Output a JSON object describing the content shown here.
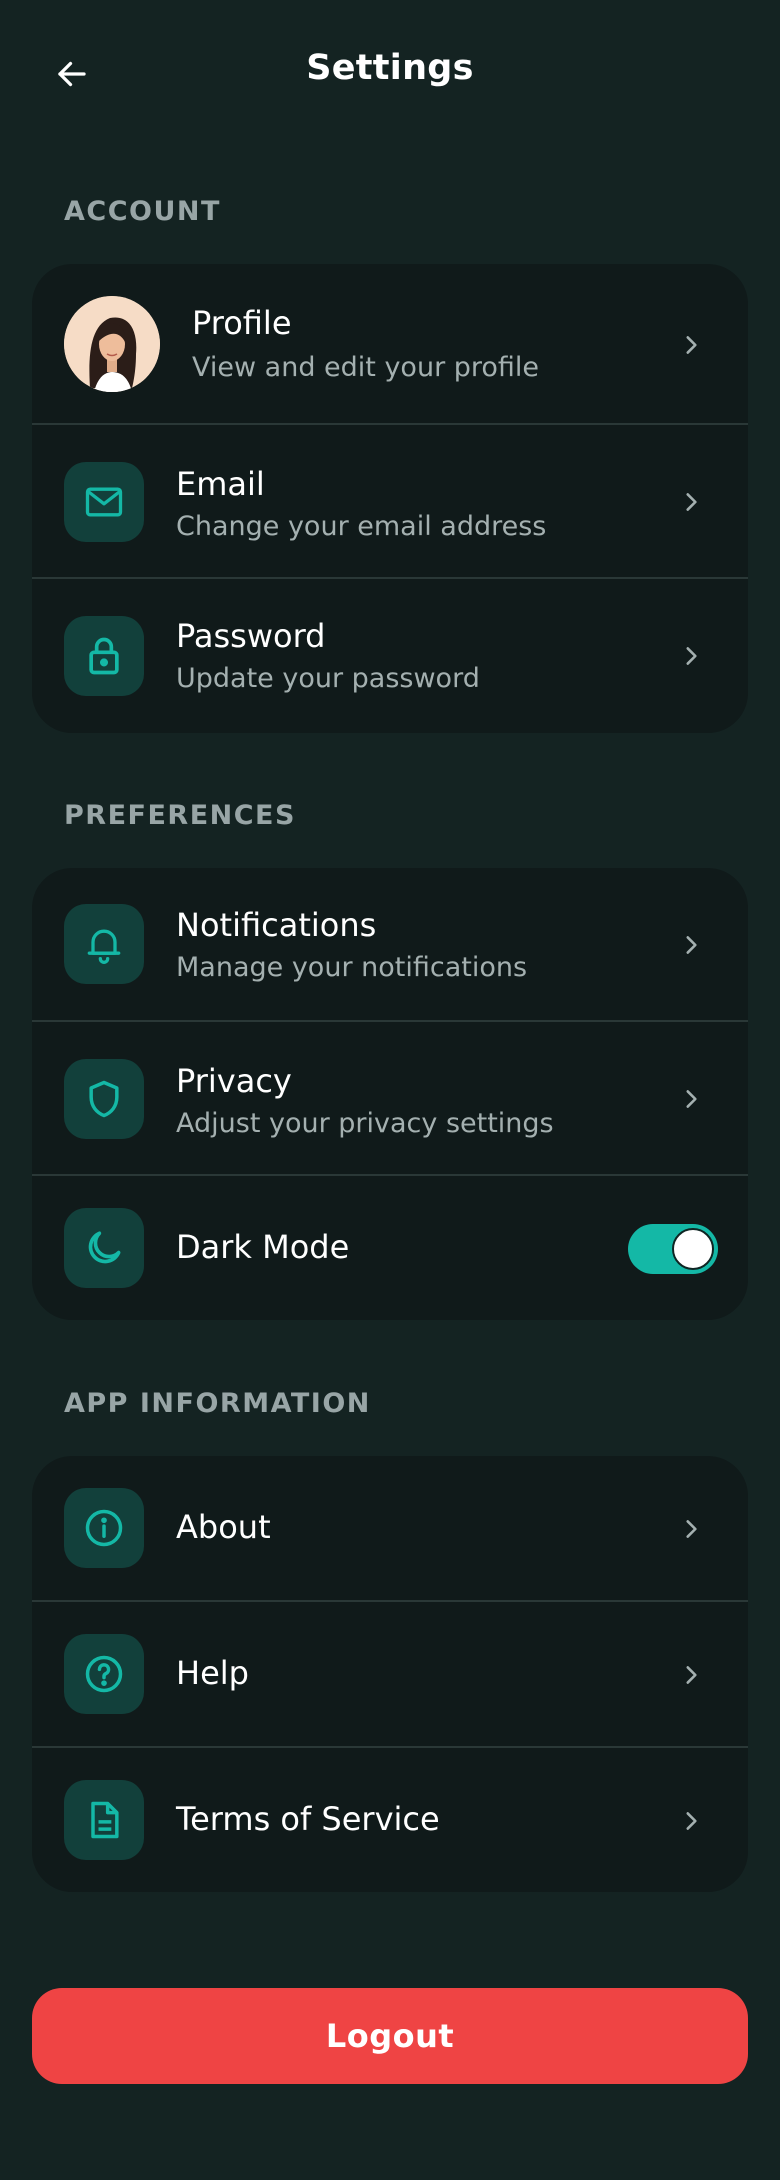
{
  "header": {
    "title": "Settings",
    "back_icon": "arrow-left-icon"
  },
  "colors": {
    "background": "#142322",
    "card": "#101a1a",
    "accent": "#14b8a6",
    "icon_bg": "#12403b",
    "danger": "#ef4444",
    "muted": "#a4b0b0"
  },
  "account": {
    "label": "ACCOUNT",
    "items": [
      {
        "title": "Profile",
        "subtitle": "View and edit your profile",
        "icon": "avatar"
      },
      {
        "title": "Email",
        "subtitle": "Change your email address",
        "icon": "mail-icon"
      },
      {
        "title": "Password",
        "subtitle": "Update your password",
        "icon": "lock-icon"
      }
    ]
  },
  "preferences": {
    "label": "PREFERENCES",
    "items": [
      {
        "title": "Notifications",
        "subtitle": "Manage your notifications",
        "icon": "bell-icon"
      },
      {
        "title": "Privacy",
        "subtitle": "Adjust your privacy settings",
        "icon": "shield-icon"
      },
      {
        "title": "Dark Mode",
        "icon": "moon-icon",
        "toggle_on": true
      }
    ]
  },
  "app_info": {
    "label": "APP INFORMATION",
    "items": [
      {
        "title": "About",
        "icon": "info-icon"
      },
      {
        "title": "Help",
        "icon": "help-circle-icon"
      },
      {
        "title": "Terms of Service",
        "icon": "document-icon"
      }
    ]
  },
  "logout": {
    "label": "Logout"
  }
}
